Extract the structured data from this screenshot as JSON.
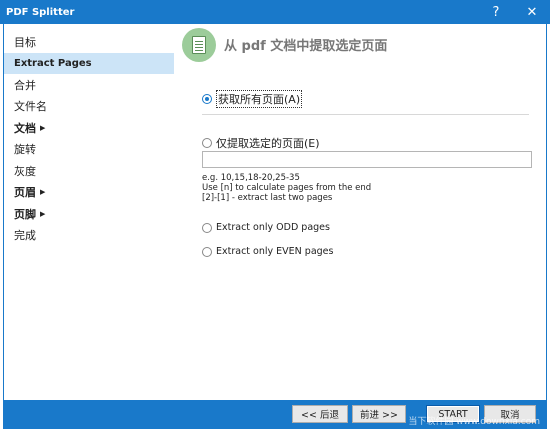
{
  "window": {
    "title": "PDF Splitter",
    "help": "?",
    "close": "✕"
  },
  "sidebar": {
    "items": [
      {
        "label": "目标"
      },
      {
        "label": "Extract Pages"
      },
      {
        "label": "合并"
      },
      {
        "label": "文件名"
      },
      {
        "label": "文档"
      },
      {
        "label": "旋转"
      },
      {
        "label": "灰度"
      },
      {
        "label": "页眉"
      },
      {
        "label": "页脚"
      },
      {
        "label": "完成"
      }
    ]
  },
  "content": {
    "header_title": "从 pdf 文档中提取选定页面",
    "option_all": "获取所有页面(A)",
    "option_selected": "仅提取选定的页面(E)",
    "range_value": "",
    "hint_lines": [
      "e.g. 10,15,18-20,25-35",
      "Use [n] to calculate pages from the end",
      "[2]-[1] - extract last two pages"
    ],
    "option_odd": "Extract only ODD pages",
    "option_even": "Extract only EVEN pages"
  },
  "buttons": {
    "back": "<< 后退",
    "next": "前进 >>",
    "start": "START",
    "cancel": "取消"
  },
  "watermark": "当下软件园 www.downxia.com",
  "colors": {
    "accent": "#1979ca",
    "active_item": "#cce4f7",
    "icon_green": "#9ccc9a"
  }
}
